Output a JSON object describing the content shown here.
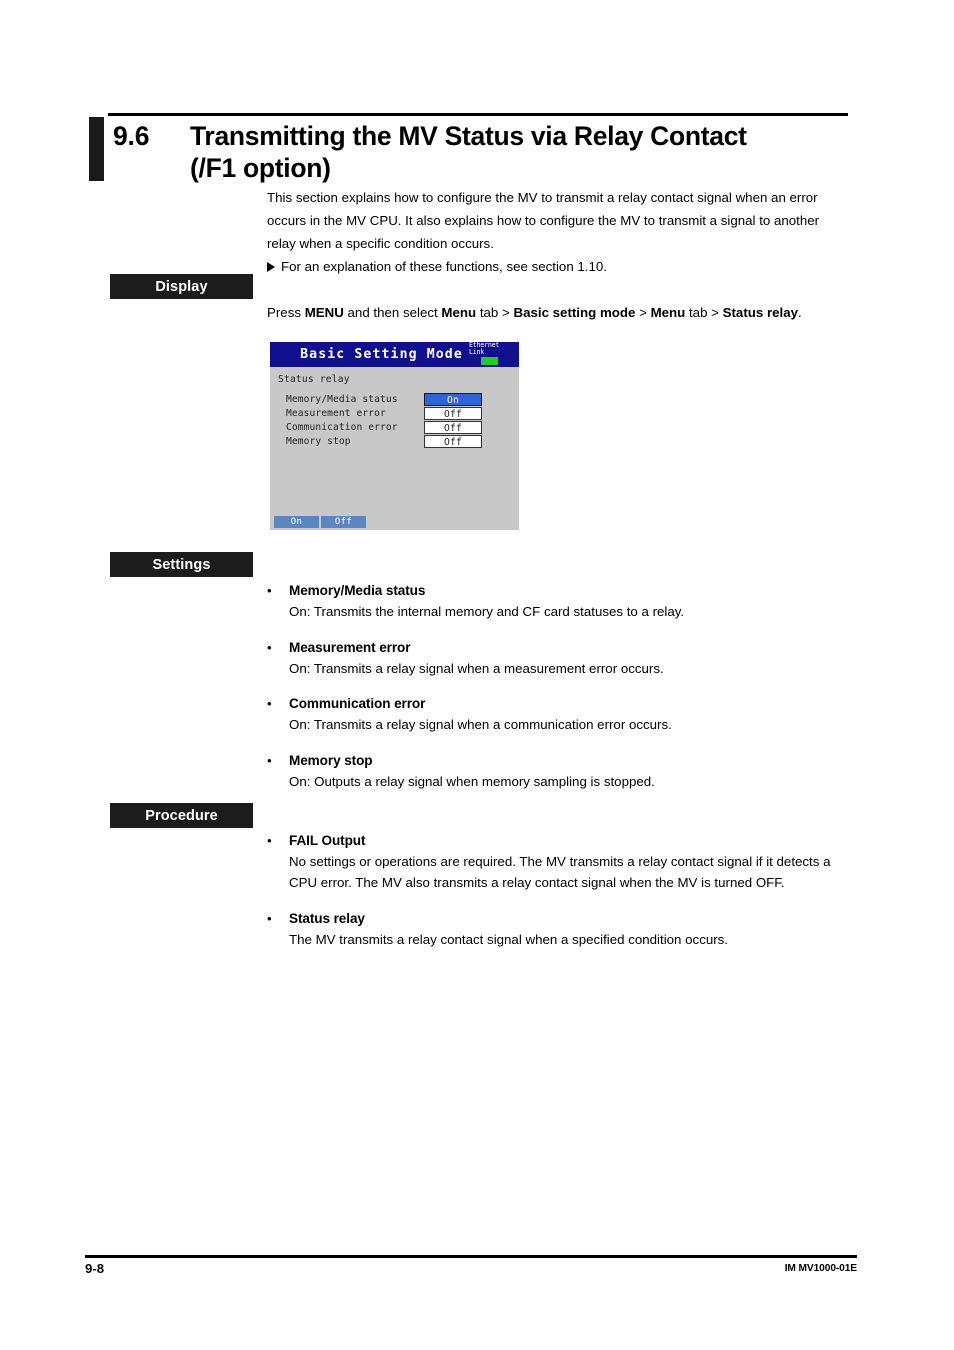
{
  "section": {
    "number": "9.6",
    "title_line1": "Transmitting the MV Status via Relay Contact",
    "title_line2": "(/F1 option)"
  },
  "intro": {
    "paragraph": "This section explains how to configure the MV to transmit a relay contact signal when an error occurs in the MV CPU. It also explains how to configure the MV to transmit a signal to another relay when a specific condition occurs.",
    "cross_reference": "For an explanation of these functions, see section 1.10."
  },
  "headings": {
    "display": "Display",
    "settings": "Settings",
    "procedure": "Procedure"
  },
  "menu_path": {
    "press": "Press ",
    "menu_key": "MENU",
    "then": " and then select ",
    "step1": "Menu",
    "tab1": " tab > ",
    "step2": "Basic setting mode",
    "sep2": " > ",
    "step3": "Menu",
    "tab3": " tab > ",
    "step4": "Status relay",
    "period": "."
  },
  "device_screen": {
    "header_title": "Basic Setting Mode",
    "ethernet_label_line1": "Ethernet",
    "ethernet_label_line2": "Link",
    "ethernet_led_color": "#22cc22",
    "header_color": "#10108e",
    "body_color": "#c8c8c8",
    "selected_color": "#2f63d8",
    "softkey_color": "#5c86c0",
    "subtitle": "Status relay",
    "rows": [
      {
        "label": "Memory/Media status",
        "value": "On",
        "selected": true
      },
      {
        "label": "Measurement error",
        "value": "Off",
        "selected": false
      },
      {
        "label": "Communication error",
        "value": "Off",
        "selected": false
      },
      {
        "label": "Memory stop",
        "value": "Off",
        "selected": false
      }
    ],
    "softkeys": [
      {
        "label": "On"
      },
      {
        "label": "Off"
      }
    ]
  },
  "settings_items": [
    {
      "bullet": "•",
      "title": "Memory/Media status",
      "desc": "On: Transmits the internal memory and CF card statuses to a relay."
    },
    {
      "bullet": "•",
      "title": "Measurement error",
      "desc": "On: Transmits a relay signal when a measurement error occurs."
    },
    {
      "bullet": "•",
      "title": "Communication error",
      "desc": "On: Transmits a relay signal when a communication error occurs."
    },
    {
      "bullet": "•",
      "title": "Memory stop",
      "desc": "On: Outputs a relay signal when memory sampling is stopped."
    }
  ],
  "procedure_items": [
    {
      "bullet": "•",
      "title": "FAIL Output",
      "desc": "No settings or operations are required. The MV transmits a relay contact signal if it detects a CPU error. The MV also transmits a relay contact signal when the MV is turned OFF."
    },
    {
      "bullet": "•",
      "title": "Status relay",
      "desc": "The MV transmits a relay contact signal when a specified condition occurs."
    }
  ],
  "footer": {
    "page_number": "9-8",
    "document_id": "IM MV1000-01E"
  }
}
